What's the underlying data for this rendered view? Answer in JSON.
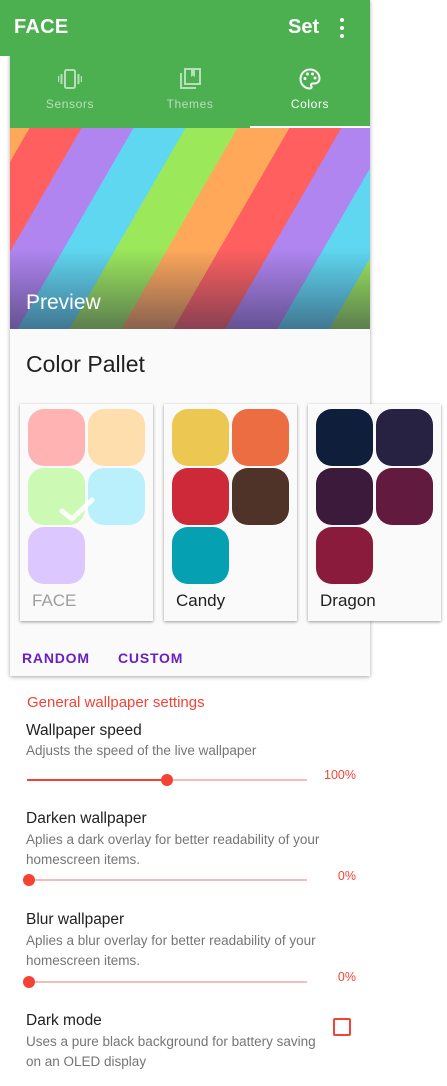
{
  "appbar": {
    "title": "FACE",
    "set_label": "Set"
  },
  "tabs": [
    {
      "label": "Sensors",
      "icon": "vibration-icon",
      "active": false
    },
    {
      "label": "Themes",
      "icon": "collections-icon",
      "active": false
    },
    {
      "label": "Colors",
      "icon": "palette-icon",
      "active": true
    }
  ],
  "preview": {
    "label": "Preview"
  },
  "pallet": {
    "title": "Color Pallet",
    "palettes": [
      {
        "name": "FACE",
        "selected": true,
        "colors": [
          "#ffb3b3",
          "#ffdeae",
          "#ccf9b4",
          "#b9f0fb",
          "#ddc7ff"
        ]
      },
      {
        "name": "Candy",
        "selected": false,
        "colors": [
          "#ecc751",
          "#ec6d42",
          "#cd2939",
          "#4f3228",
          "#05a0b1"
        ]
      },
      {
        "name": "Dragon",
        "selected": false,
        "colors": [
          "#0e1e3b",
          "#272242",
          "#3c1a3c",
          "#621b3e",
          "#8a1b3c"
        ]
      }
    ],
    "actions": {
      "random_label": "RANDOM",
      "custom_label": "CUSTOM"
    }
  },
  "settings": {
    "section_title": "General wallpaper settings",
    "speed": {
      "title": "Wallpaper speed",
      "summary": "Adjusts the speed of the live wallpaper",
      "value_text": "100%",
      "level": 0.5
    },
    "darken": {
      "title": "Darken wallpaper",
      "summary": "Aplies a dark overlay for better readability of your homescreen items.",
      "value_text": "0%",
      "level": 0
    },
    "blur": {
      "title": "Blur wallpaper",
      "summary": "Aplies a blur overlay for better readability of your homescreen items.",
      "value_text": "0%",
      "level": 0
    },
    "dark_mode": {
      "title": "Dark mode",
      "summary": "Uses a pure black background for battery saving on an OLED display",
      "checked": false
    }
  },
  "colors": {
    "primary": "#4caf50",
    "accent": "#f44336",
    "button_text": "#6a1fc2"
  }
}
